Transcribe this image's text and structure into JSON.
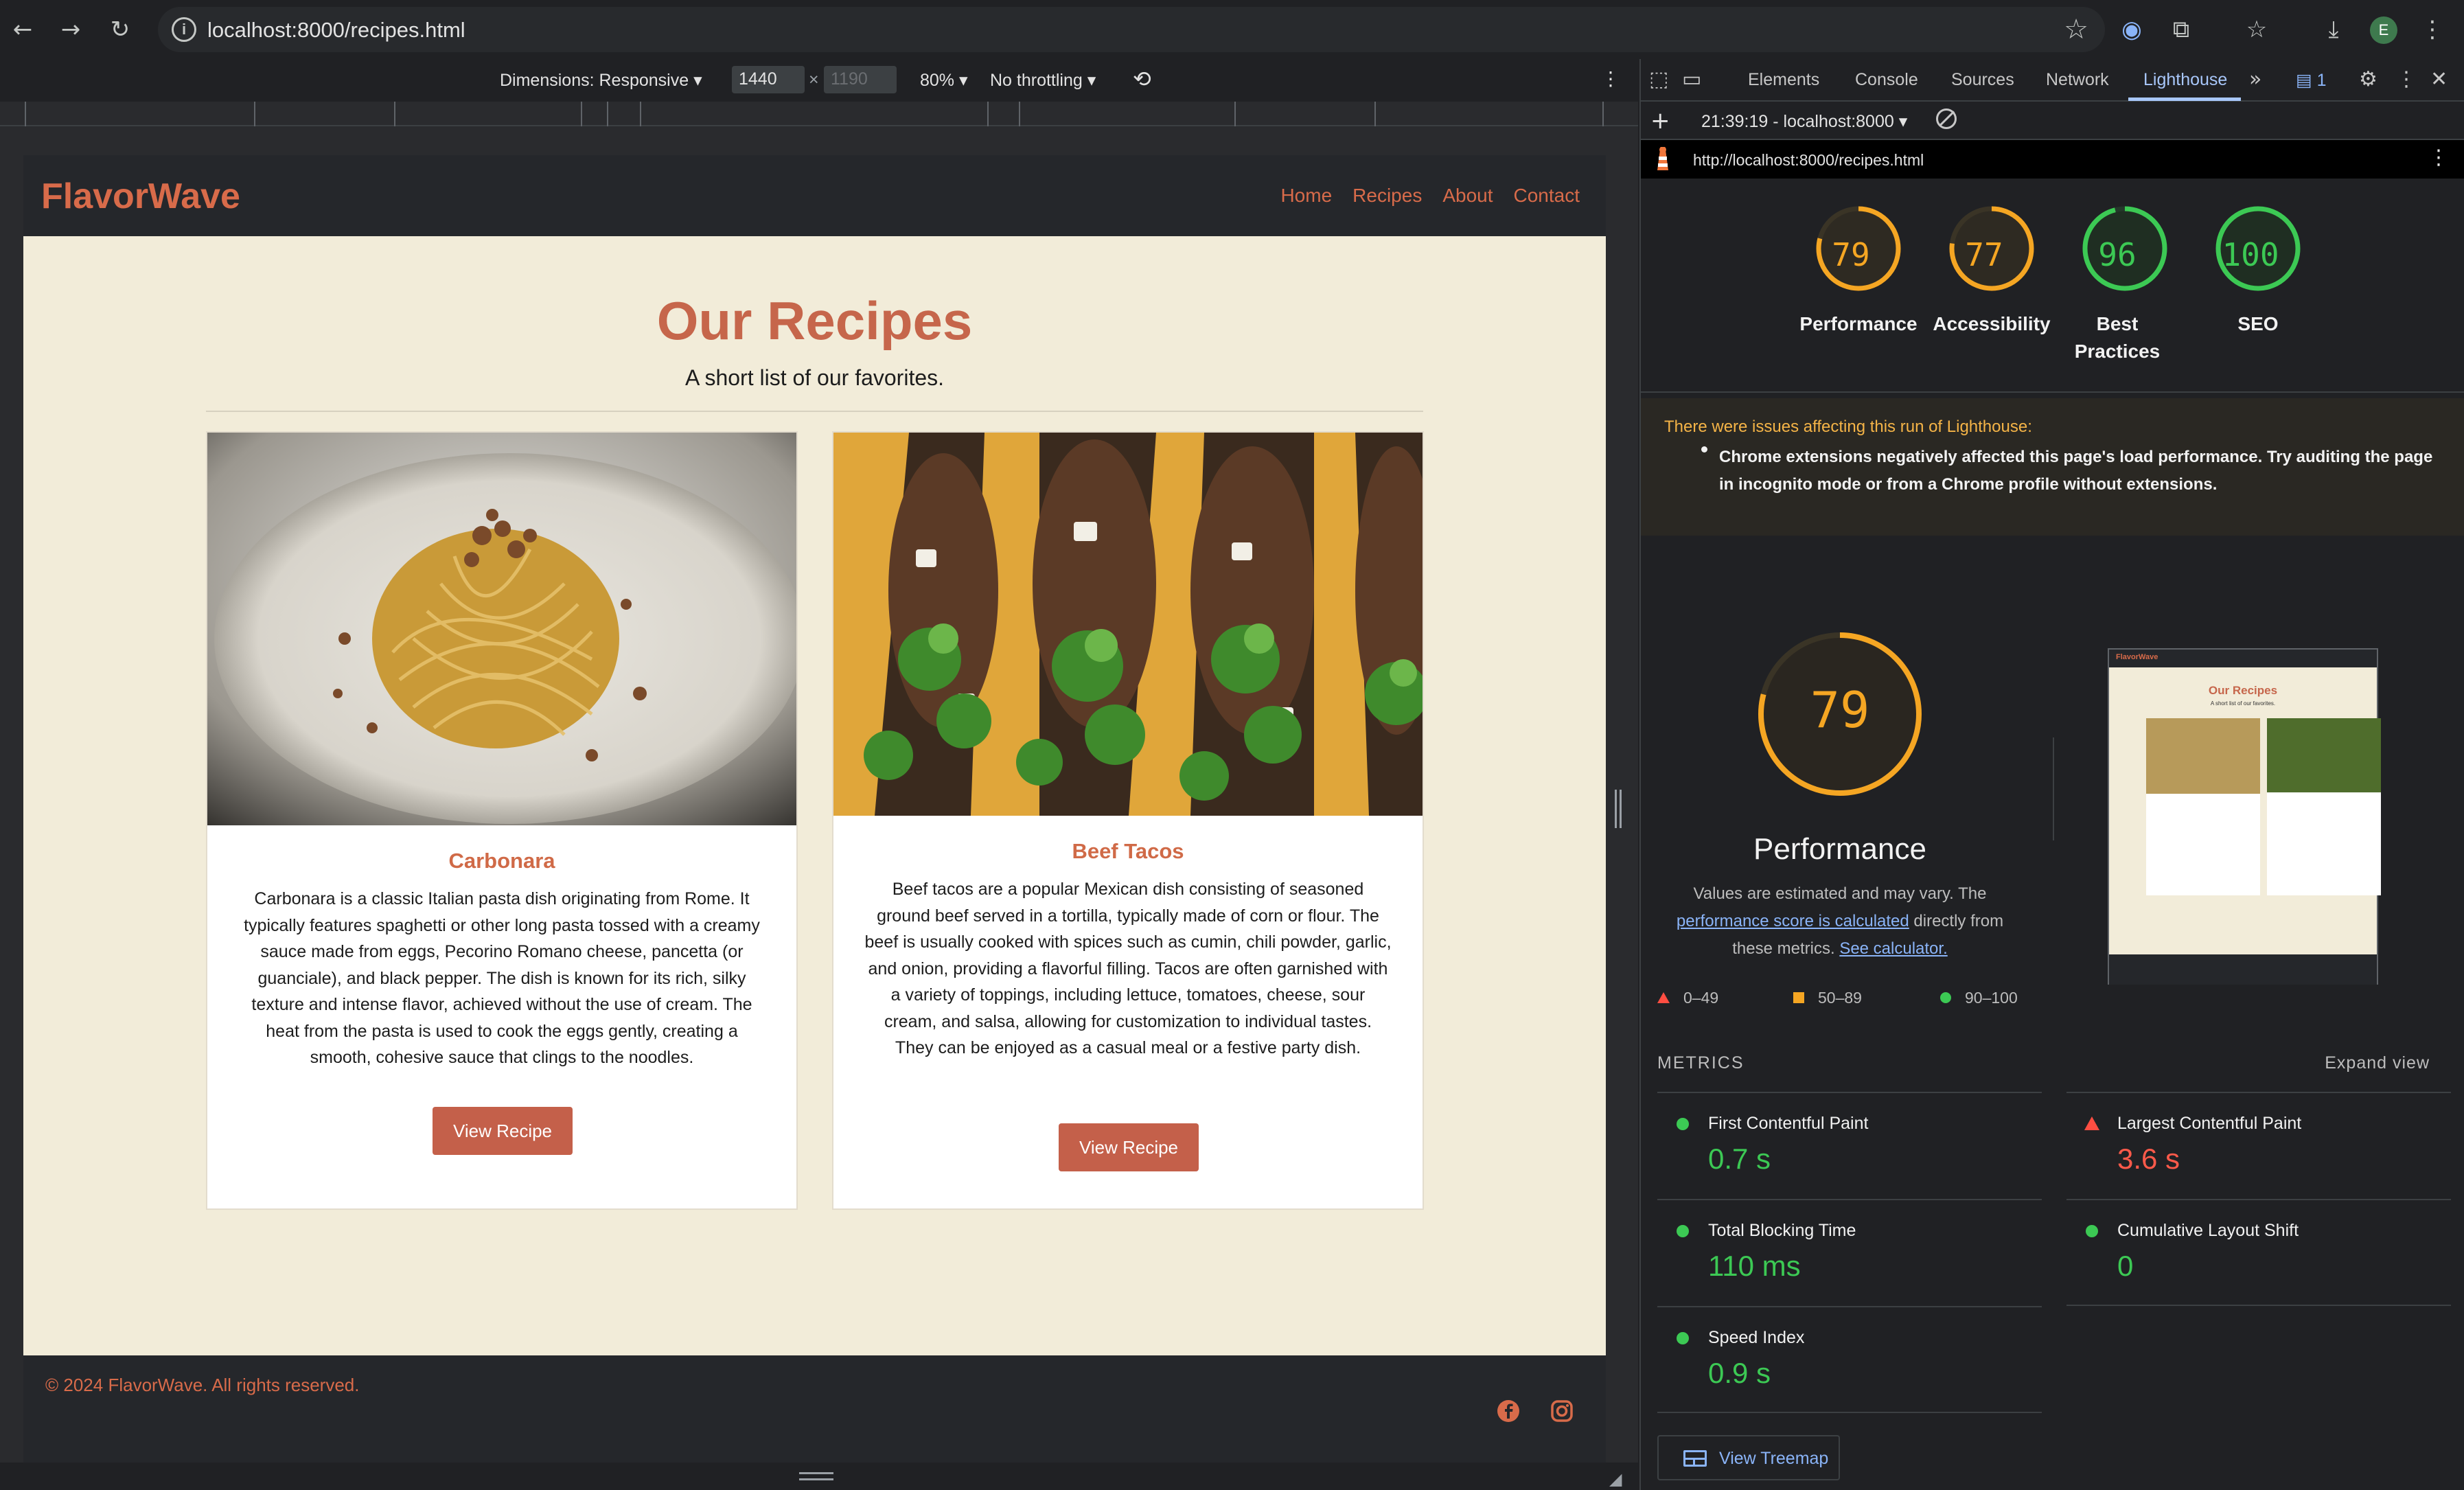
{
  "browser": {
    "url": "localhost:8000/recipes.html",
    "profile_initial": "E",
    "icons": [
      "back-icon",
      "forward-icon",
      "reload-icon",
      "info-icon",
      "bookmark-star-icon",
      "translate-icon",
      "extensions-icon",
      "bookmarks-icon",
      "download-icon"
    ]
  },
  "device_toolbar": {
    "dimensions_label": "Dimensions: Responsive",
    "width_value": "1440",
    "times": "×",
    "height_placeholder": "1190",
    "zoom": "80%",
    "throttling": "No throttling"
  },
  "site": {
    "logo": "FlavorWave",
    "nav": [
      "Home",
      "Recipes",
      "About",
      "Contact"
    ],
    "title": "Our Recipes",
    "subtitle": "A short list of our favorites.",
    "cards": [
      {
        "title": "Carbonara",
        "description": "Carbonara is a classic Italian pasta dish originating from Rome. It typically features spaghetti or other long pasta tossed with a creamy sauce made from eggs, Pecorino Romano cheese, pancetta (or guanciale), and black pepper. The dish is known for its rich, silky texture and intense flavor, achieved without the use of cream. The heat from the pasta is used to cook the eggs gently, creating a smooth, cohesive sauce that clings to the noodles.",
        "button": "View Recipe"
      },
      {
        "title": "Beef Tacos",
        "description": "Beef tacos are a popular Mexican dish consisting of seasoned ground beef served in a tortilla, typically made of corn or flour. The beef is usually cooked with spices such as cumin, chili powder, garlic, and onion, providing a flavorful filling. Tacos are often garnished with a variety of toppings, including lettuce, tomatoes, cheese, sour cream, and salsa, allowing for customization to individual tastes. They can be enjoyed as a casual meal or a festive party dish.",
        "button": "View Recipe"
      }
    ],
    "footer": "© 2024 FlavorWave. All rights reserved.",
    "social_icons": [
      "facebook-icon",
      "instagram-icon"
    ]
  },
  "devtools": {
    "tabs": [
      "Elements",
      "Console",
      "Sources",
      "Network",
      "Lighthouse"
    ],
    "active_tab": "Lighthouse",
    "issues_count": "1",
    "report_selector": "21:39:19 - localhost:8000",
    "report_url": "http://localhost:8000/recipes.html",
    "scores": [
      {
        "label": "Performance",
        "value": 79,
        "color": "#f5a623"
      },
      {
        "label": "Accessibility",
        "value": 77,
        "color": "#f5a623"
      },
      {
        "label": "Best Practices",
        "value": 96,
        "color": "#3cc954"
      },
      {
        "label": "SEO",
        "value": 100,
        "color": "#3cc954"
      }
    ],
    "warning_title": "There were issues affecting this run of Lighthouse:",
    "warning_text": "Chrome extensions negatively affected this page's load performance. Try auditing the page in incognito mode or from a Chrome profile without extensions.",
    "big_score": 79,
    "big_label": "Performance",
    "note_prefix": "Values are estimated and may vary. The",
    "note_link1": "performance score is calculated",
    "note_middle": "directly from these metrics.",
    "note_link2": "See calculator.",
    "legend": [
      "0–49",
      "50–89",
      "90–100"
    ],
    "thumb": {
      "logo": "FlavorWave",
      "title": "Our Recipes",
      "subtitle": "A short list of our favorites."
    },
    "metrics_label": "METRICS",
    "expand_label": "Expand view",
    "metrics": [
      {
        "name": "First Contentful Paint",
        "value": "0.7 s",
        "status": "pass"
      },
      {
        "name": "Largest Contentful Paint",
        "value": "3.6 s",
        "status": "fail"
      },
      {
        "name": "Total Blocking Time",
        "value": "110 ms",
        "status": "pass"
      },
      {
        "name": "Cumulative Layout Shift",
        "value": "0",
        "status": "pass"
      },
      {
        "name": "Speed Index",
        "value": "0.9 s",
        "status": "pass"
      }
    ],
    "treemap_button": "View Treemap"
  }
}
